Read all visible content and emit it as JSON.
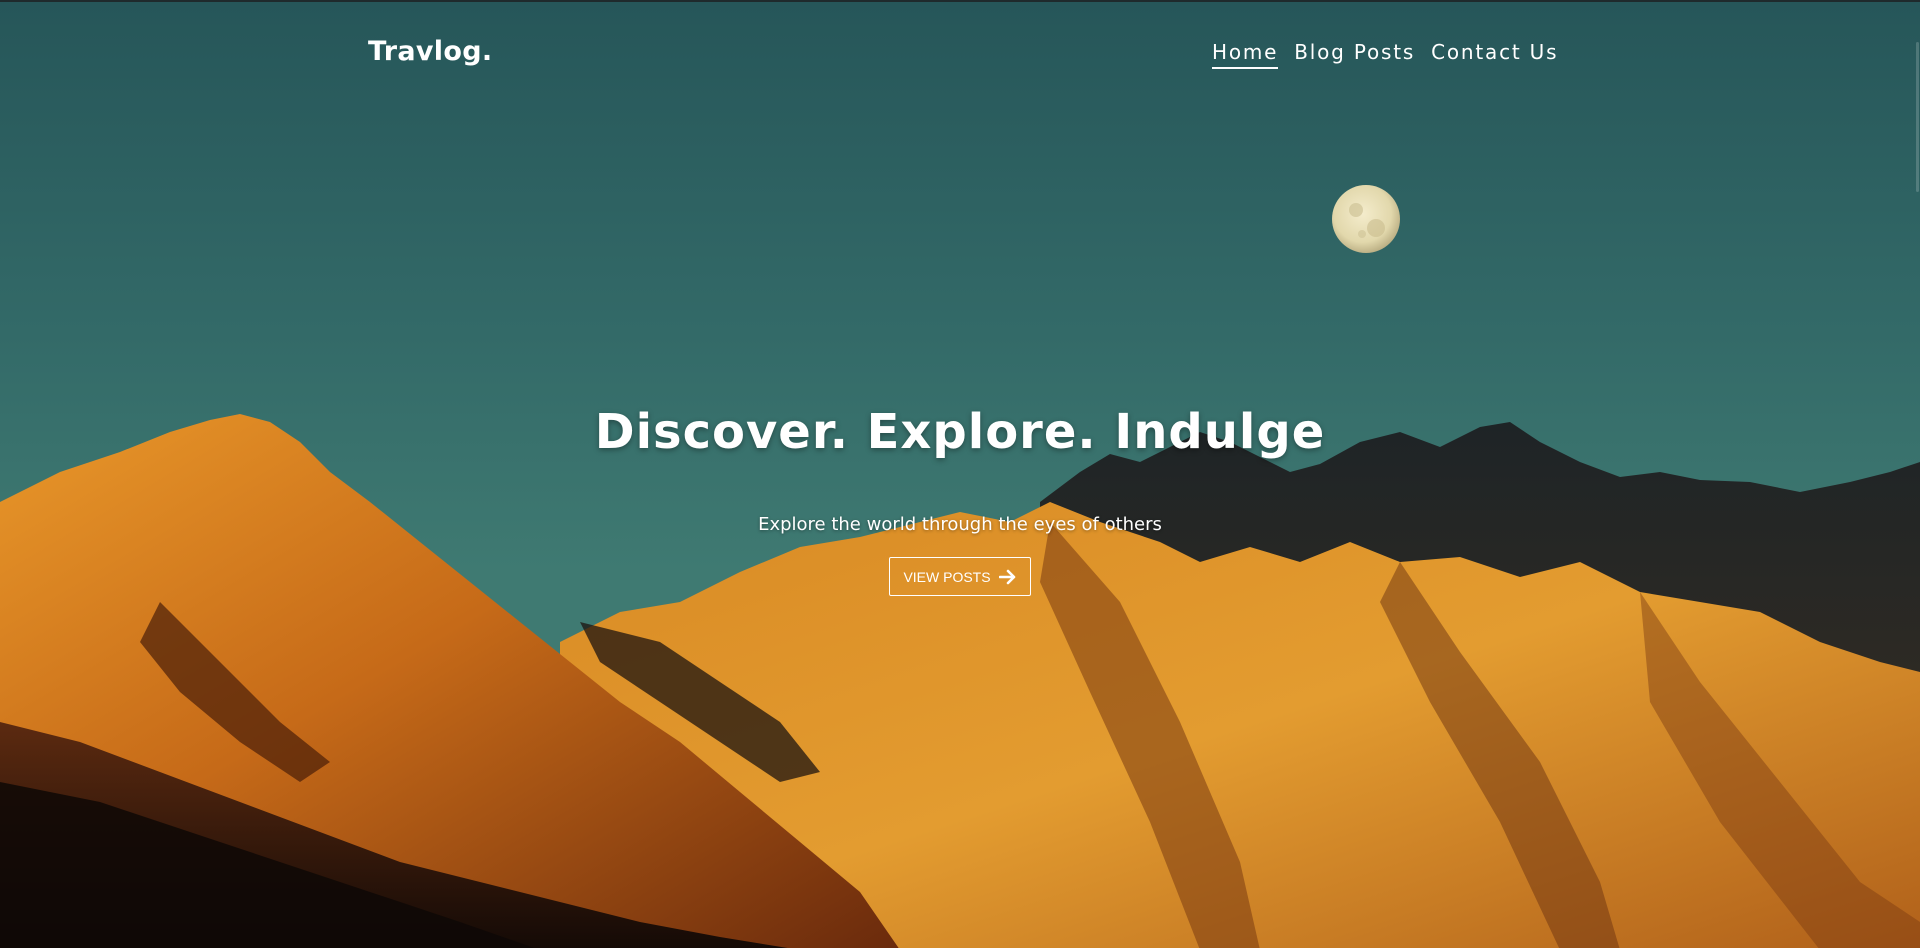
{
  "brand": {
    "logo": "Travlog."
  },
  "nav": {
    "items": [
      {
        "label": "Home",
        "active": true
      },
      {
        "label": "Blog Posts",
        "active": false
      },
      {
        "label": "Contact Us",
        "active": false
      }
    ]
  },
  "hero": {
    "headline": "Discover. Explore. Indulge",
    "subheadline": "Explore the world through the eyes of others",
    "cta_label": "VIEW POSTS",
    "cta_icon": "arrow-right-icon",
    "background_image": "moon-over-orange-mountains",
    "colors": {
      "sky": "#3a7470",
      "mountain": "#d6801e",
      "text": "#ffffff"
    }
  }
}
